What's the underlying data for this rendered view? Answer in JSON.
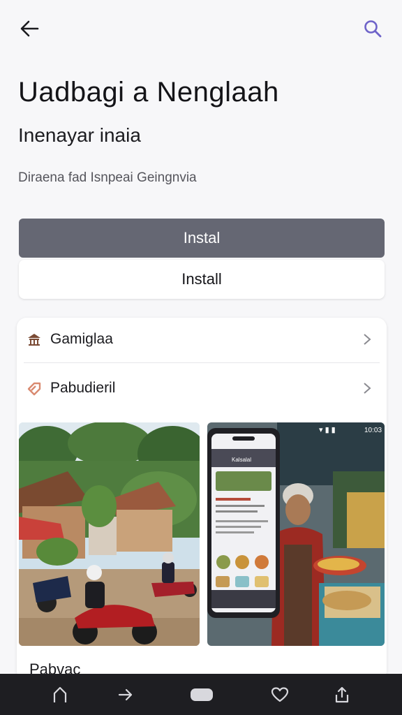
{
  "header": {
    "back_icon": "arrow-left-icon",
    "search_icon": "search-icon",
    "accent_color": "#6e63c9"
  },
  "app": {
    "title": "Uadbagi a Nenglaah",
    "subtitle": "Inenayar inaia",
    "meta": "Diraena fad Isnpeai Geingnvia"
  },
  "buttons": {
    "install_primary": "Instal",
    "install_secondary": "Install"
  },
  "details": {
    "rows": [
      {
        "label": "Gamiglaa",
        "icon": "temple-icon"
      },
      {
        "label": "Pabudieril",
        "icon": "tag-icon"
      }
    ]
  },
  "screenshots": {
    "left": "village-street-motorbikes-photo",
    "right": "phone-app-market-vendor-photo",
    "phone_app_header": "Kalsalal",
    "phone_status_time": "10:03"
  },
  "section": {
    "label": "Pabvac"
  },
  "navbar": {
    "home_icon": "home-icon",
    "forward_icon": "forward-arrow-icon",
    "pill_icon": "recents-pill-icon",
    "heart_icon": "heart-icon",
    "share_icon": "share-icon"
  }
}
